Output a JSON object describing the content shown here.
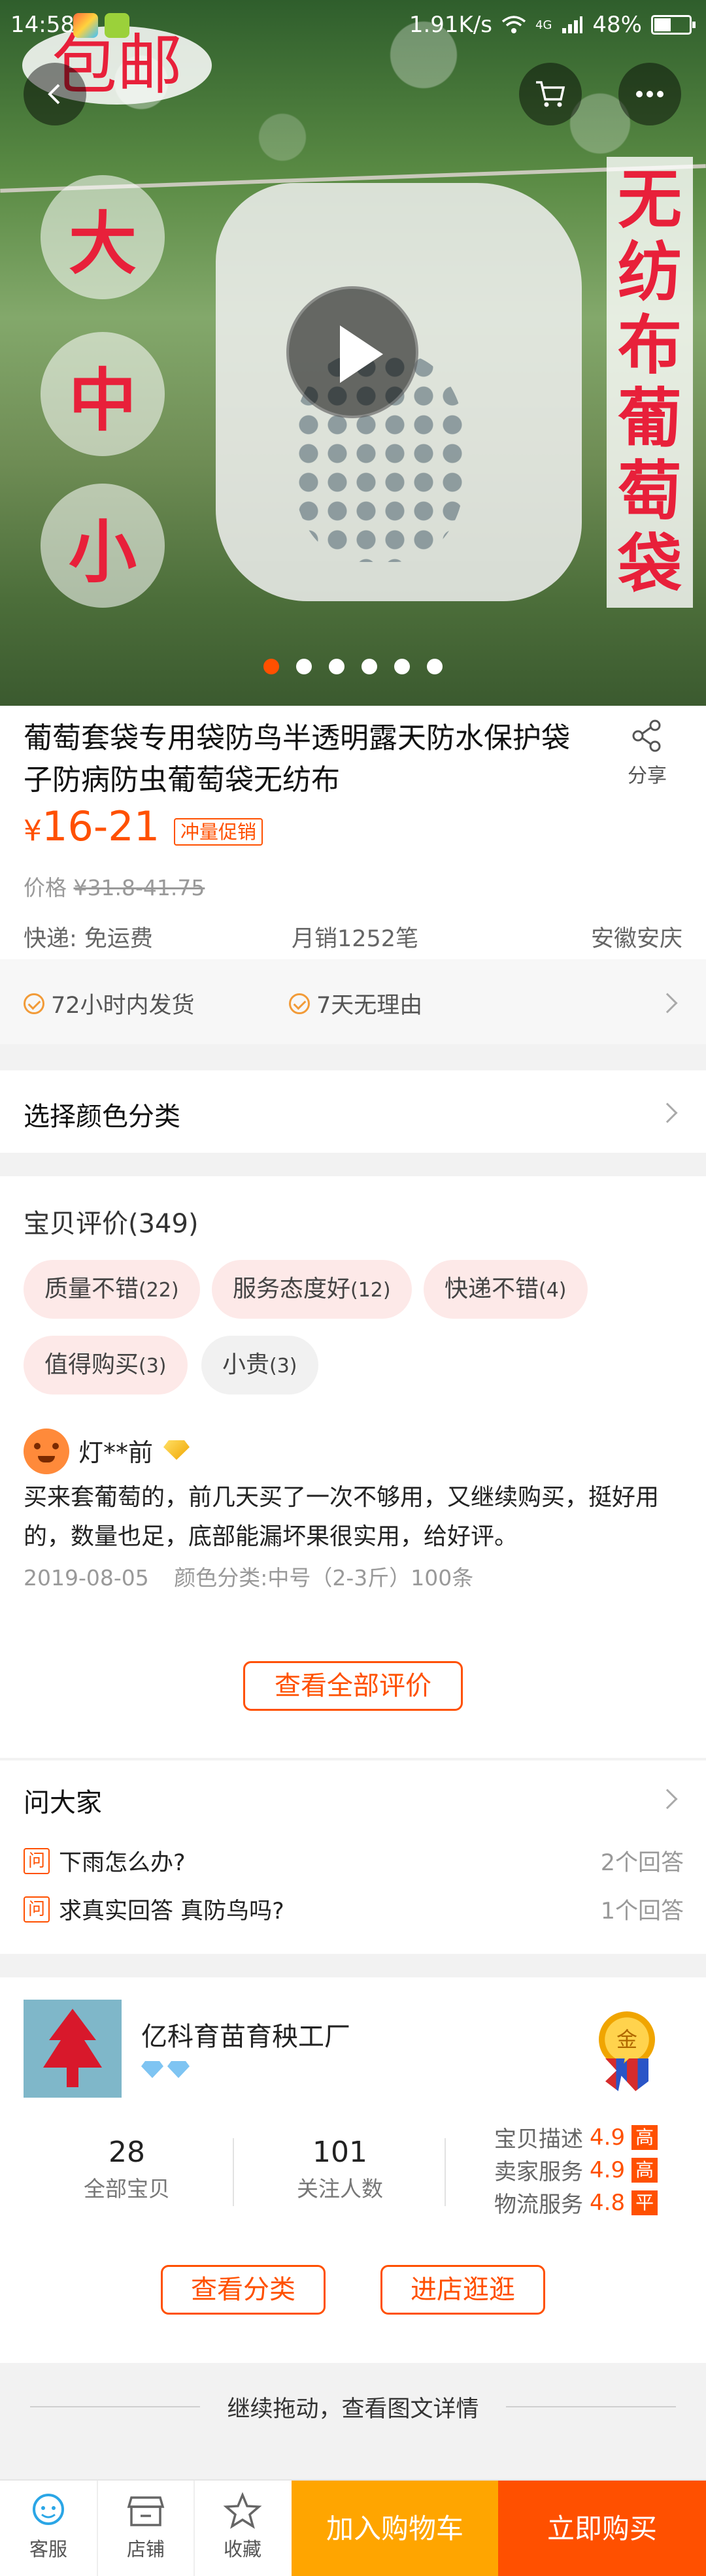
{
  "status_bar": {
    "time": "14:58",
    "network": "1.91K/s",
    "battery": "48%",
    "battery_level": 0.48,
    "signal": "4G"
  },
  "hero": {
    "banner_top": "包邮",
    "sizes": [
      "大",
      "中",
      "小"
    ],
    "vertical_text": [
      "无",
      "纺",
      "布",
      "葡",
      "萄",
      "袋"
    ],
    "slide_count": 6,
    "active_slide": 1
  },
  "product": {
    "title": "葡萄套袋专用袋防鸟半透明露天防水保护袋子防病防虫葡萄袋无纺布",
    "share_label": "分享",
    "price_symbol": "¥",
    "price": "16-21",
    "promo_tag": "冲量促销",
    "original_price_label": "价格",
    "original_price": "¥31.8-41.75",
    "shipping": "快递: 免运费",
    "monthly_sales": "月销1252笔",
    "location": "安徽安庆"
  },
  "guarantees": [
    "72小时内发货",
    "7天无理由"
  ],
  "sku": {
    "label": "选择颜色分类"
  },
  "reviews": {
    "title": "宝贝评价(349)",
    "tags": [
      {
        "label": "质量不错",
        "count": "(22)"
      },
      {
        "label": "服务态度好",
        "count": "(12)"
      },
      {
        "label": "快递不错",
        "count": "(4)"
      },
      {
        "label": "值得购买",
        "count": "(3)"
      },
      {
        "label": "小贵",
        "count": "(3)"
      }
    ],
    "item": {
      "user": "灯**前",
      "text": "买来套葡萄的，前几天买了一次不够用，又继续购买，挺好用的，数量也足，底部能漏坏果很实用，给好评。",
      "date": "2019-08-05",
      "spec": "颜色分类:中号（2-3斤）100条"
    },
    "view_all": "查看全部评价"
  },
  "qa": {
    "title": "问大家",
    "badge": "问",
    "items": [
      {
        "question": "下雨怎么办?",
        "answers": "2个回答"
      },
      {
        "question": "求真实回答 真防鸟吗?",
        "answers": "1个回答"
      }
    ]
  },
  "shop": {
    "name": "亿科育苗育秧工厂",
    "medal": "金",
    "stats": [
      {
        "value": "28",
        "label": "全部宝贝"
      },
      {
        "value": "101",
        "label": "关注人数"
      }
    ],
    "scores": [
      {
        "label": "宝贝描述",
        "value": "4.9",
        "level": "高"
      },
      {
        "label": "卖家服务",
        "value": "4.9",
        "level": "高"
      },
      {
        "label": "物流服务",
        "value": "4.8",
        "level": "平"
      }
    ],
    "btn_category": "查看分类",
    "btn_enter": "进店逛逛"
  },
  "continue_hint": "继续拖动，查看图文详情",
  "bottom_bar": {
    "service": "客服",
    "shop": "店铺",
    "favorite": "收藏",
    "add_cart": "加入购物车",
    "buy_now": "立即购买"
  },
  "colors": {
    "accent": "#ff5000",
    "cart": "#ffa500",
    "banner_red": "#e8203a"
  }
}
